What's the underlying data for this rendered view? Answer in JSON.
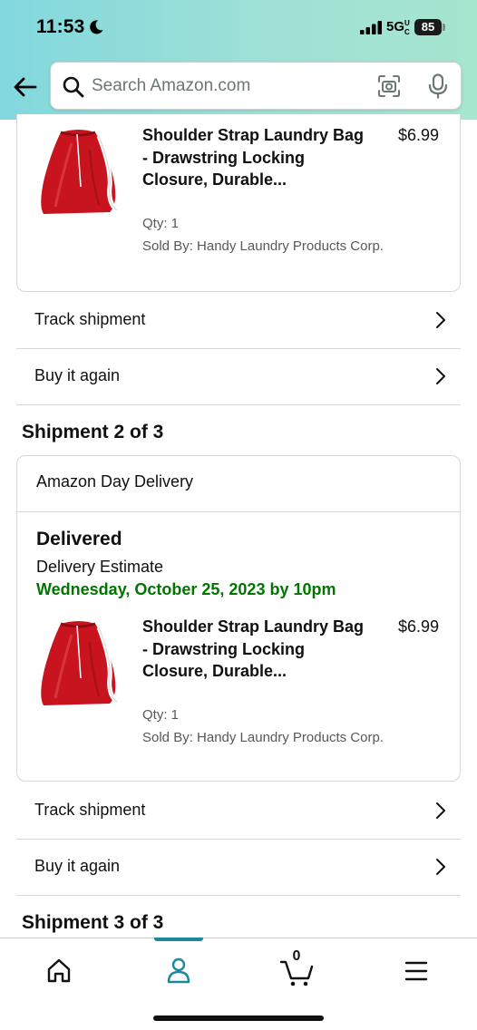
{
  "status_bar": {
    "time": "11:53",
    "network": "5G",
    "network_sup": "UC",
    "battery": "85"
  },
  "search": {
    "placeholder": "Search Amazon.com"
  },
  "shipment_1": {
    "product": {
      "title": "Shoulder Strap Laundry Bag - Drawstring Locking Closure, Durable...",
      "price": "$6.99",
      "qty": "Qty: 1",
      "seller": "Sold By: Handy Laundry Products Corp."
    },
    "actions": [
      {
        "label": "Track shipment"
      },
      {
        "label": "Buy it again"
      }
    ]
  },
  "shipment_2": {
    "heading": "Shipment 2 of 3",
    "delivery_type": "Amazon Day Delivery",
    "status": "Delivered",
    "estimate_label": "Delivery Estimate",
    "estimate_date": "Wednesday, October 25, 2023 by 10pm",
    "product": {
      "title": "Shoulder Strap Laundry Bag - Drawstring Locking Closure, Durable...",
      "price": "$6.99",
      "qty": "Qty: 1",
      "seller": "Sold By: Handy Laundry Products Corp."
    },
    "actions": [
      {
        "label": "Track shipment"
      },
      {
        "label": "Buy it again"
      }
    ]
  },
  "shipment_3": {
    "heading": "Shipment 3 of 3"
  },
  "bottom_nav": {
    "items": [
      {
        "icon": "home-icon"
      },
      {
        "icon": "account-icon",
        "active": true
      },
      {
        "icon": "cart-icon"
      },
      {
        "icon": "menu-icon"
      }
    ],
    "cart_count": "0",
    "active_color": "#1a8a9a"
  },
  "colors": {
    "header_gradient_start": "#82d8de",
    "header_gradient_end": "#a6e6cf",
    "delivery_green": "#007600",
    "bag_red": "#c8141e"
  }
}
